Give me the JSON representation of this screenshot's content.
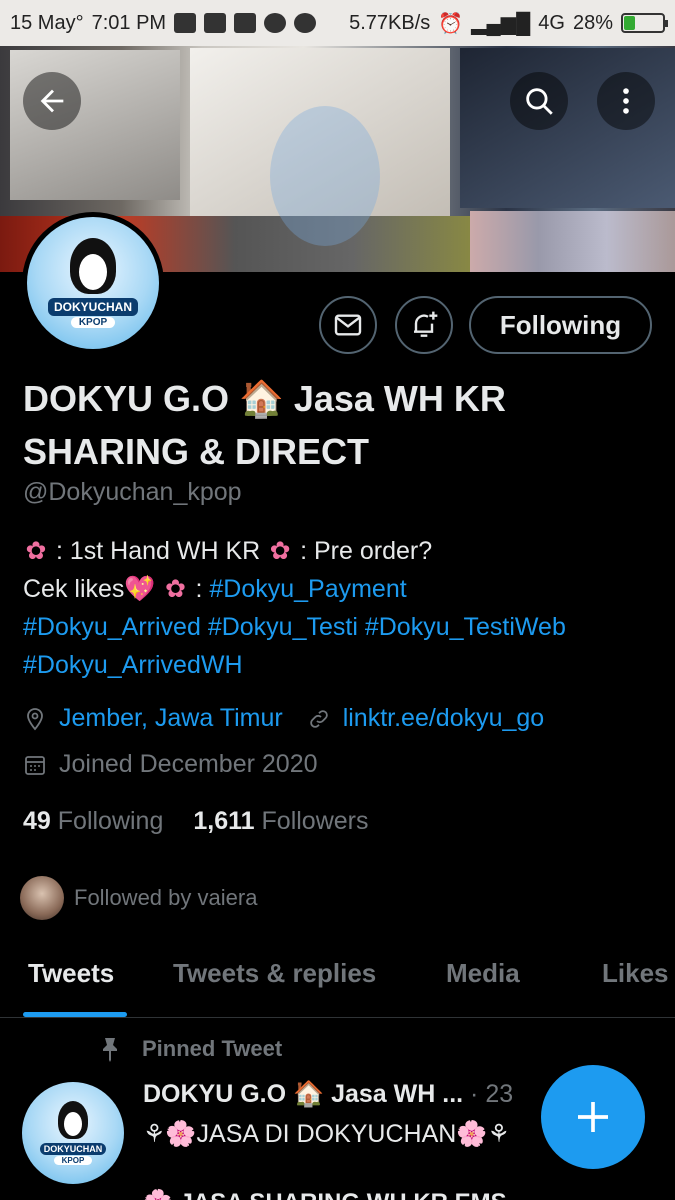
{
  "status_bar": {
    "date": "15 May°",
    "time": "7:01 PM",
    "speed": "5.77KB/s",
    "network": "4G",
    "battery": "28%",
    "battery_level": 0.28
  },
  "profile": {
    "name": "DOKYU G.O 🏠 Jasa WH KR SHARING & DIRECT",
    "handle": "@Dokyuchan_kpop",
    "avatar_text": "DOKYUCHAN",
    "avatar_subtext": "KPOP",
    "bio_line1_a": ": 1st Hand WH KR",
    "bio_line1_b": ": Pre order?",
    "bio_line2_a": "Cek likes💖",
    "bio_line2_b": ":",
    "bio_tag_payment": "#Dokyu_Payment",
    "bio_tag_arrived": "#Dokyu_Arrived",
    "bio_tag_testi": "#Dokyu_Testi",
    "bio_tag_testiweb": "#Dokyu_TestiWeb",
    "bio_tag_arrivedwh": "#Dokyu_ArrivedWH",
    "location": "Jember, Jawa Timur",
    "website": "linktr.ee/dokyu_go",
    "joined": "Joined December 2020",
    "following_count": "49",
    "following_label": "Following",
    "followers_count": "1,611",
    "followers_label": "Followers",
    "followed_by": "Followed by vaiera"
  },
  "actions": {
    "message_icon": "envelope-icon",
    "notify_icon": "bell-plus-icon",
    "following_button": "Following"
  },
  "tabs": [
    "Tweets",
    "Tweets & replies",
    "Media",
    "Likes"
  ],
  "pinned_tweet": {
    "label": "Pinned Tweet",
    "author": "DOKYU G.O 🏠 Jasa WH ...",
    "time": "· 23",
    "text": "⚘🌸JASA DI DOKYUCHAN🌸⚘",
    "next_line": "🌸 JASA SHARING WH KR EMS"
  },
  "colors": {
    "accent": "#1d9bf0",
    "background": "#000000",
    "muted": "#71767b"
  }
}
